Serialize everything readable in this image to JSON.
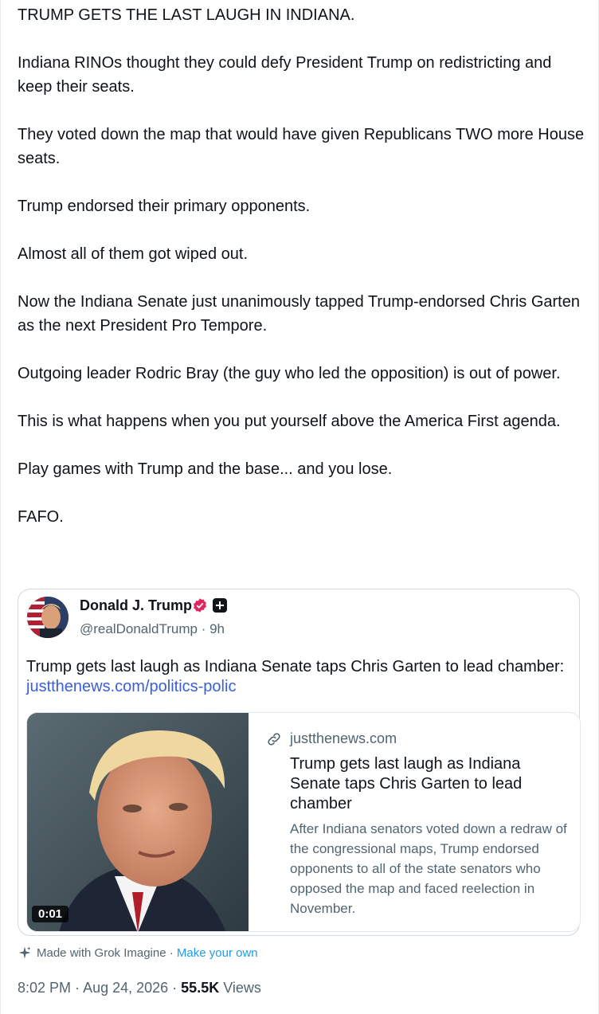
{
  "post": {
    "paragraphs": [
      "TRUMP GETS THE LAST LAUGH IN INDIANA.",
      "Indiana RINOs thought they could defy President Trump on redistricting and keep their seats.",
      "They voted down the map that would have given Republicans TWO more House seats.",
      "Trump endorsed their primary opponents.",
      "Almost all of them got wiped out.",
      "Now the Indiana Senate just unanimously tapped Trump-endorsed Chris Garten as the next President Pro Tempore.",
      "Outgoing leader Rodric Bray (the guy who led the opposition) is out of power.",
      "This is what happens when you put yourself above the America First agenda.",
      "Play games with Trump and the base... and you lose.",
      "FAFO."
    ]
  },
  "quote": {
    "author_name": "Donald J. Trump",
    "handle": "@realDonaldTrump",
    "time": "9h",
    "text": "Trump gets last laugh as Indiana Senate taps Chris Garten to lead chamber: ",
    "link": "justthenews.com/politics-polic",
    "card": {
      "domain": "justthenews.com",
      "title": "Trump gets last laugh as Indiana Senate taps Chris Garten to lead chamber",
      "description": "After Indiana senators voted down a redraw of the congressional maps, Trump endorsed opponents to all of the state senators who opposed the map and faced reelection in November.",
      "video_time": "0:01"
    }
  },
  "footer": {
    "made_with": "Made with Grok Imagine",
    "separator": " · ",
    "make_own": "Make your own"
  },
  "meta": {
    "time": "8:02 PM",
    "date": "Aug 24, 2026",
    "views_count": "55.5K",
    "views_label": "Views"
  },
  "colors": {
    "link": "#3b5fd6",
    "muted": "#536471",
    "verified": "#e0245e"
  }
}
